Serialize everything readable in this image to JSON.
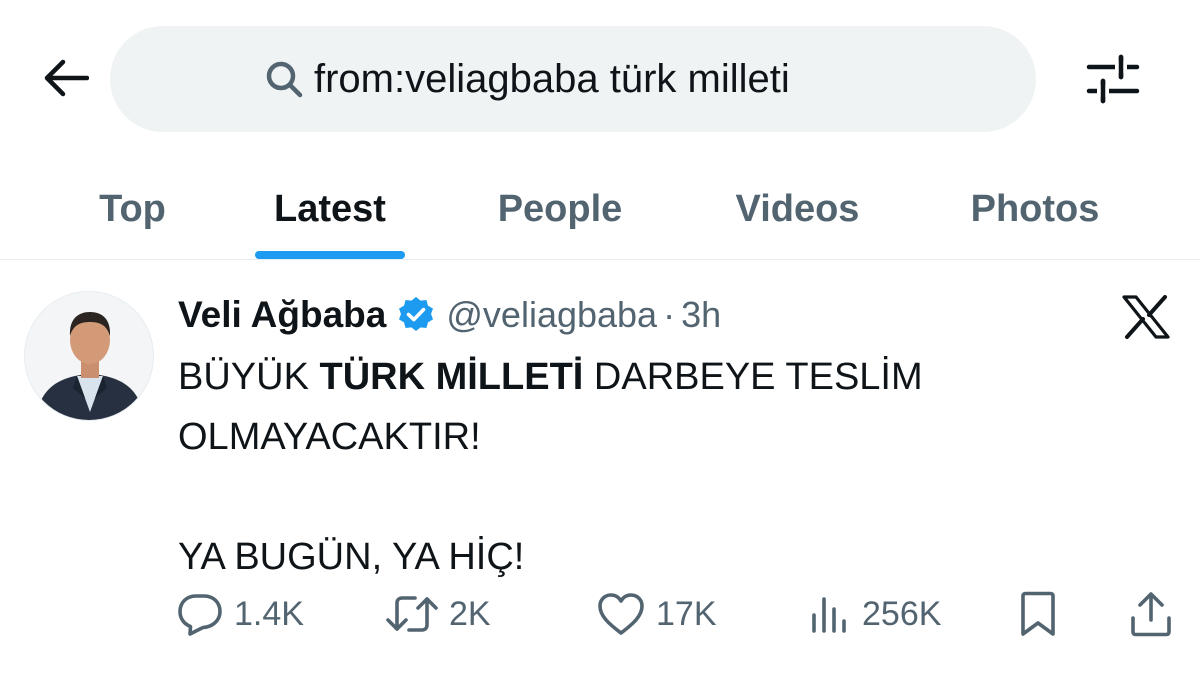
{
  "search": {
    "query": "from:veliagbaba türk milleti"
  },
  "tabs": [
    {
      "label": "Top",
      "active": false
    },
    {
      "label": "Latest",
      "active": true
    },
    {
      "label": "People",
      "active": false
    },
    {
      "label": "Videos",
      "active": false
    },
    {
      "label": "Photos",
      "active": false
    }
  ],
  "tweet": {
    "author_name": "Veli Ağbaba",
    "handle": "@veliagbaba",
    "separator": "·",
    "time": "3h",
    "text": {
      "part1": "BÜYÜK ",
      "bold": "TÜRK MİLLETİ",
      "part2": " DARBEYE TESLİM",
      "line2": "OLMAYACAKTIR!",
      "line3": "YA BUGÜN, YA HİÇ!"
    },
    "stats": {
      "replies": "1.4K",
      "reposts": "2K",
      "likes": "17K",
      "views": "256K"
    }
  },
  "icons": {
    "back": "arrow-left-icon",
    "search": "search-icon",
    "filter": "sliders-icon",
    "verified": "verified-badge-icon",
    "brand": "x-logo-icon",
    "reply": "reply-icon",
    "repost": "repost-icon",
    "like": "heart-icon",
    "views": "views-icon",
    "bookmark": "bookmark-icon",
    "share": "share-icon"
  },
  "colors": {
    "accent": "#1d9bf0",
    "muted": "#536471",
    "text": "#0f1419",
    "search_bg": "#eff3f4"
  }
}
